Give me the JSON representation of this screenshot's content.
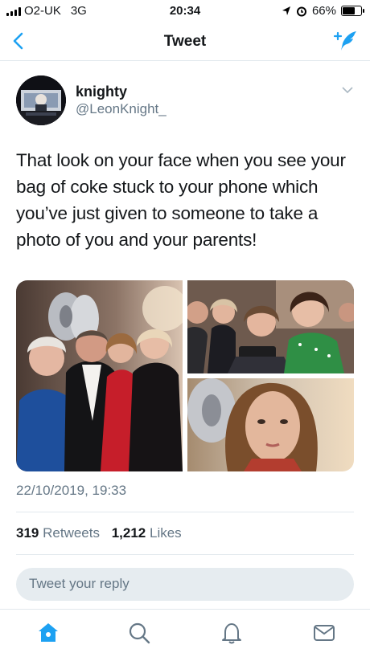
{
  "status_bar": {
    "carrier": "O2-UK",
    "network": "3G",
    "time": "20:34",
    "battery": "66%",
    "icons": [
      "signal-icon",
      "location-arrow-icon",
      "alarm-icon",
      "battery-icon"
    ]
  },
  "nav": {
    "title": "Tweet",
    "back_icon": "chevron-left-icon",
    "compose_icon": "compose-tweet-icon"
  },
  "tweet": {
    "author_name": "knighty",
    "author_handle": "@LeonKnight_",
    "text": "That look on your face when you see your bag of coke stuck to your phone which you’ve just given to someone to take a photo of you and your parents!",
    "timestamp": "22/10/2019, 19:33",
    "retweets_count": "319",
    "retweets_label": "Retweets",
    "likes_count": "1,212",
    "likes_label": "Likes"
  },
  "reply": {
    "placeholder": "Tweet your reply"
  },
  "tabbar": {
    "items": [
      "home-icon",
      "search-icon",
      "notifications-icon",
      "messages-icon"
    ],
    "active": "home-icon"
  },
  "colors": {
    "accent": "#1da1f2",
    "text": "#14171a",
    "secondary": "#657786",
    "divider": "#e1e8ed"
  }
}
